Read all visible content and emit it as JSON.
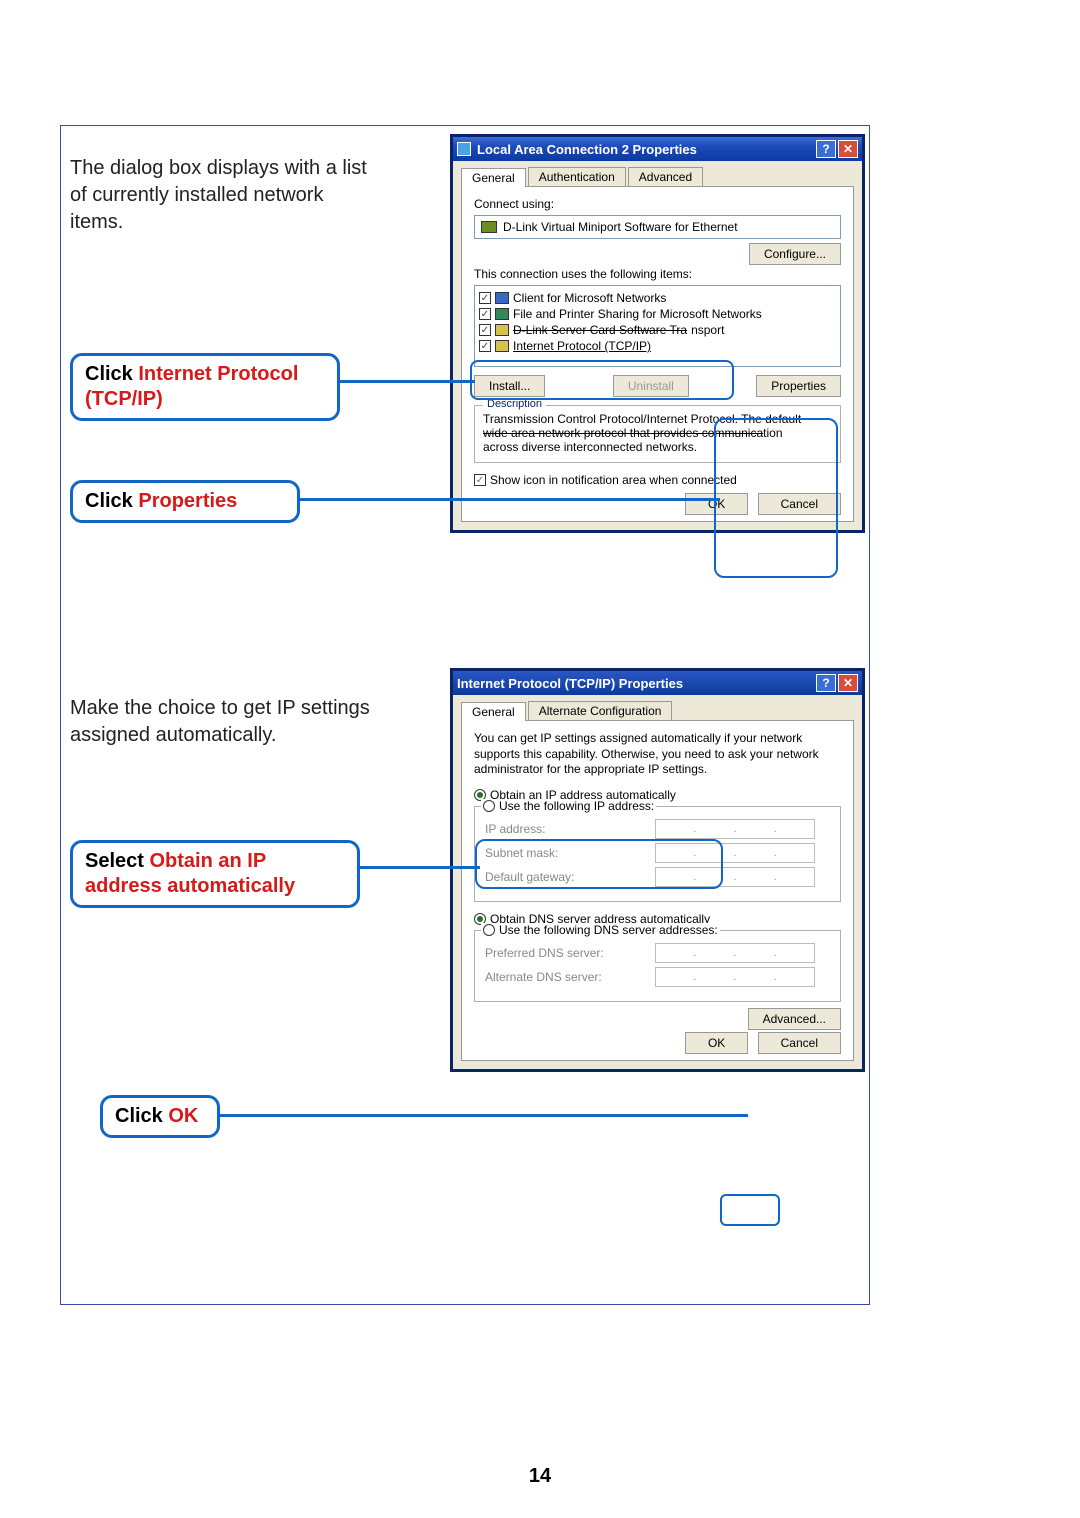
{
  "intro1": "The dialog box displays with a list of currently installed network items.",
  "intro2": "Make the choice to get IP settings assigned automatically.",
  "callouts": {
    "c1_black": "Click ",
    "c1_red": "Internet Protocol (TCP/IP)",
    "c2_black": "Click ",
    "c2_red": "Properties",
    "c3_black": "Select ",
    "c3_red": "Obtain an IP address automatically",
    "c4_black": "Click ",
    "c4_red": "OK"
  },
  "dialog1": {
    "title": "Local Area Connection 2 Properties",
    "tabs": {
      "general": "General",
      "auth": "Authentication",
      "adv": "Advanced"
    },
    "connect_using": "Connect using:",
    "adapter": "D-Link Virtual Miniport Software for Ethernet",
    "configure": "Configure...",
    "uses_items": "This connection uses the following items:",
    "items": {
      "i1": "Client for Microsoft Networks",
      "i2": "File and Printer Sharing for Microsoft Networks",
      "i3a": "D-Link Server Card Software Tra",
      "i3b": "nsport",
      "i4": "Internet Protocol (TCP/IP)"
    },
    "install": "Install...",
    "uninstall": "Uninstall",
    "properties": "Properties",
    "desc_legend": "Description",
    "desc_l1": "Transmission Control Protocol/Internet Protocol. The default",
    "desc_l2a": "wide area network protocol that provides communica",
    "desc_l2b": "tion",
    "desc_l3": "across diverse interconnected networks.",
    "show_icon": "Show icon in notification area when connected",
    "ok": "OK",
    "cancel": "Cancel"
  },
  "dialog2": {
    "title": "Internet Protocol (TCP/IP) Properties",
    "tabs": {
      "general": "General",
      "alt": "Alternate Configuration"
    },
    "intro": "You can get IP settings assigned automatically if your network supports this capability. Otherwise, you need to ask your network administrator for the appropriate IP settings.",
    "r1": "Obtain an IP address automatically",
    "r2": "Use the following IP address:",
    "ip_addr": "IP address:",
    "subnet": "Subnet mask:",
    "gateway": "Default gateway:",
    "r3": "Obtain DNS server address automatically",
    "r4": "Use the following DNS server addresses:",
    "pref_dns": "Preferred DNS server:",
    "alt_dns": "Alternate DNS server:",
    "advanced": "Advanced...",
    "ok": "OK",
    "cancel": "Cancel"
  },
  "page_number": "14"
}
